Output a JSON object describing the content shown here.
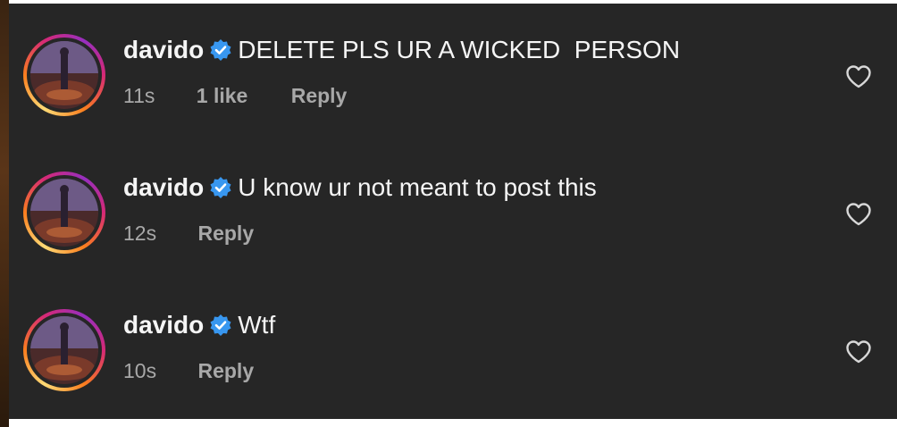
{
  "colors": {
    "panel_background": "#262626",
    "primary_text": "#f5f5f5",
    "secondary_text": "#a8a8a8",
    "verified_badge": "#3897f0"
  },
  "icons": {
    "verified": "verified-badge-icon",
    "like": "heart-outline-icon"
  },
  "comments": [
    {
      "username": "davido",
      "text": "DELETE PLS UR A WICKED  PERSON",
      "time": "11s",
      "likes": "1 like",
      "reply_label": "Reply"
    },
    {
      "username": "davido",
      "text": "U know ur not meant to post this",
      "time": "12s",
      "likes": null,
      "reply_label": "Reply"
    },
    {
      "username": "davido",
      "text": "Wtf",
      "time": "10s",
      "likes": null,
      "reply_label": "Reply"
    }
  ]
}
